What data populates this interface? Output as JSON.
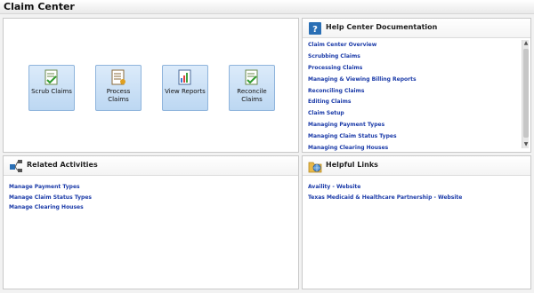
{
  "window": {
    "title": "Claim Center"
  },
  "tiles": [
    {
      "label": "Scrub Claims",
      "icon": "scrub-claims-icon"
    },
    {
      "label": "Process Claims",
      "icon": "process-claims-icon"
    },
    {
      "label": "View Reports",
      "icon": "view-reports-icon"
    },
    {
      "label": "Reconcile Claims",
      "icon": "reconcile-claims-icon"
    }
  ],
  "help": {
    "title": "Help Center Documentation",
    "icon": "help-question-icon",
    "items": [
      "Claim Center Overview",
      "Scrubbing Claims",
      "Processing Claims",
      "Managing & Viewing Billing Reports",
      "Reconciling Claims",
      "Editing Claims",
      "Claim Setup",
      "Managing Payment Types",
      "Managing Claim Status Types",
      "Managing Clearing Houses"
    ]
  },
  "related": {
    "title": "Related Activities",
    "icon": "related-activities-icon",
    "items": [
      "Manage Payment Types",
      "Manage Claim Status Types",
      "Manage Clearing Houses"
    ]
  },
  "links": {
    "title": "Helpful Links",
    "icon": "folder-globe-icon",
    "items": [
      "Availity - Website",
      "Texas Medicaid & Healthcare Partnership - Website"
    ]
  },
  "colors": {
    "link": "#1a3aa8",
    "tile_border": "#8fb4dc",
    "tile_bg": "#cfe2f6"
  }
}
